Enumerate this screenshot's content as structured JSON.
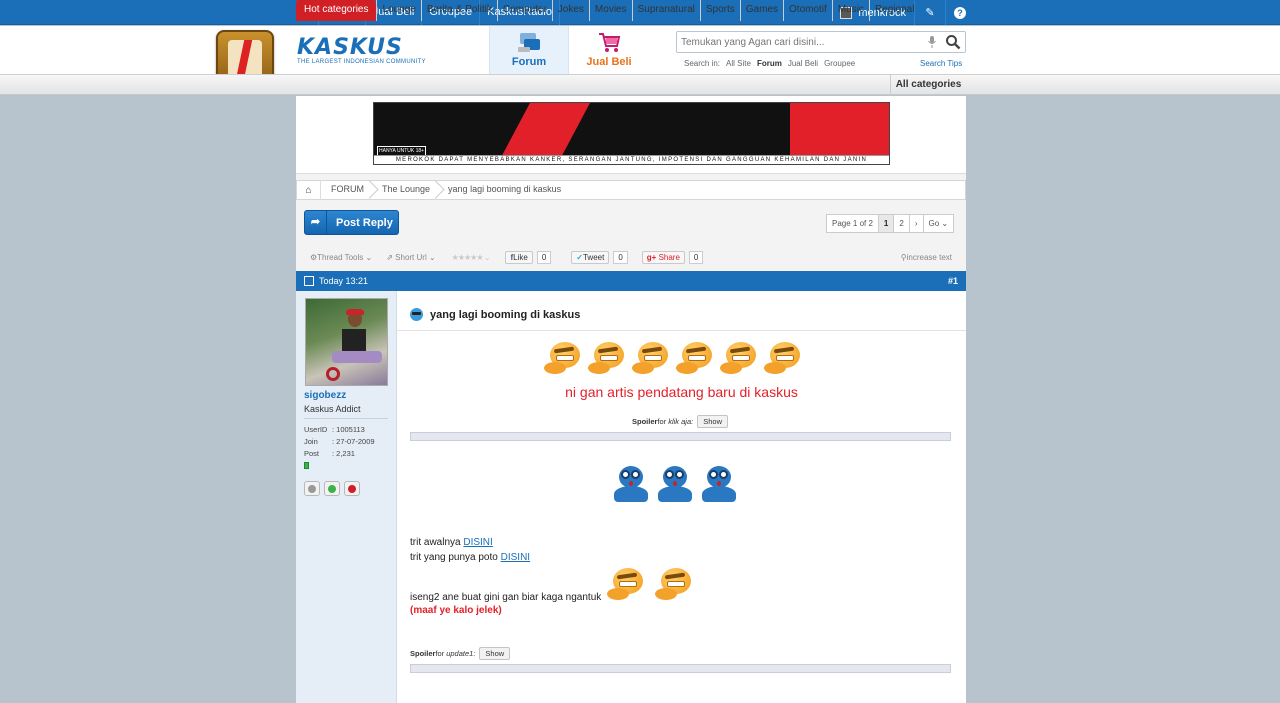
{
  "topnav": {
    "items": [
      "Forum",
      "Jual Beli",
      "Groupee",
      "KaskusRadio"
    ],
    "username": "menkrock"
  },
  "header": {
    "logo_text": "KASKUS",
    "logo_tagline": "THE LARGEST INDONESIAN COMMUNITY",
    "tabs": [
      {
        "label": "Forum",
        "active": true
      },
      {
        "label": "Jual Beli",
        "active": false
      }
    ],
    "search": {
      "placeholder": "Temukan yang Agan cari disini...",
      "search_in_label": "Search in:",
      "scopes": [
        "All Site",
        "Forum",
        "Jual Beli",
        "Groupee"
      ],
      "active_scope": "Forum",
      "tips": "Search Tips"
    }
  },
  "categories": {
    "hot": "Hot categories",
    "items": [
      "Lounge",
      "Berita & Politik",
      "Computer",
      "Jokes",
      "Movies",
      "Supranatural",
      "Sports",
      "Games",
      "Otomotif",
      "Music",
      "Regional"
    ],
    "all": "All categories"
  },
  "banner": {
    "warning": "MEROKOK DAPAT MENYEBABKAN KANKER, SERANGAN JANTUNG, IMPOTENSI DAN GANGGUAN KEHAMILAN DAN JANIN",
    "age": "HANYA UNTUK 18+"
  },
  "breadcrumb": [
    "FORUM",
    "The Lounge",
    "yang lagi booming di kaskus"
  ],
  "thread": {
    "post_reply": "Post Reply",
    "pager": {
      "label": "Page 1 of 2",
      "pages": [
        "1",
        "2"
      ],
      "current": "1",
      "next": "›",
      "go": "Go"
    },
    "tools": {
      "thread_tools": "Thread Tools",
      "short_url": "Short Url",
      "like": "Like",
      "like_count": "0",
      "tweet": "Tweet",
      "tweet_count": "0",
      "share": "Share",
      "share_count": "0",
      "increase_text": "increase text"
    }
  },
  "post": {
    "time": "Today 13:21",
    "number": "#1",
    "title": "yang lagi booming di kaskus",
    "headline": "ni gan artis pendatang baru di kaskus",
    "spoiler1": {
      "label": "Spoiler",
      "for": "for",
      "title": "klik aja:",
      "button": "Show"
    },
    "line1_text": "trit awalnya ",
    "line1_link": "DISINI",
    "line2_text": "trit yang punya poto ",
    "line2_link": "DISINI",
    "line3": "iseng2 ane buat gini gan biar kaga ngantuk",
    "sorry": "(maaf ye kalo jelek)",
    "spoiler2": {
      "label": "Spoiler",
      "for": "for",
      "title": "update1:",
      "button": "Show"
    }
  },
  "user": {
    "name": "sigobezz",
    "rank": "Kaskus Addict",
    "info": [
      {
        "key": "UserID",
        "value": ": 1005113"
      },
      {
        "key": "Join",
        "value": ": 27-07-2009"
      },
      {
        "key": "Post",
        "value": ": 2,231"
      }
    ]
  }
}
